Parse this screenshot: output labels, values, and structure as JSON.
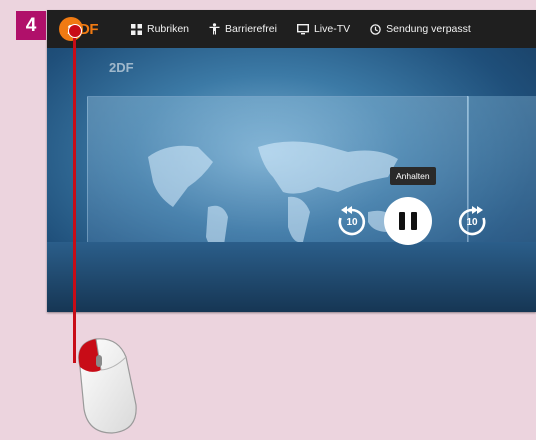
{
  "step": {
    "number": "4"
  },
  "header": {
    "logo_prefix": "2",
    "logo_rest": "DF",
    "nav": [
      {
        "label": "Rubriken",
        "icon": "grid-icon"
      },
      {
        "label": "Barrierefrei",
        "icon": "accessibility-icon"
      },
      {
        "label": "Live-TV",
        "icon": "tv-icon"
      },
      {
        "label": "Sendung verpasst",
        "icon": "clock-icon"
      }
    ]
  },
  "player": {
    "watermark": "2DF",
    "tooltip": "Anhalten",
    "skip_back_seconds": "10",
    "skip_forward_seconds": "10"
  },
  "colors": {
    "accent": "#f07a12",
    "badge": "#b0106a",
    "pointer": "#c80c17"
  }
}
